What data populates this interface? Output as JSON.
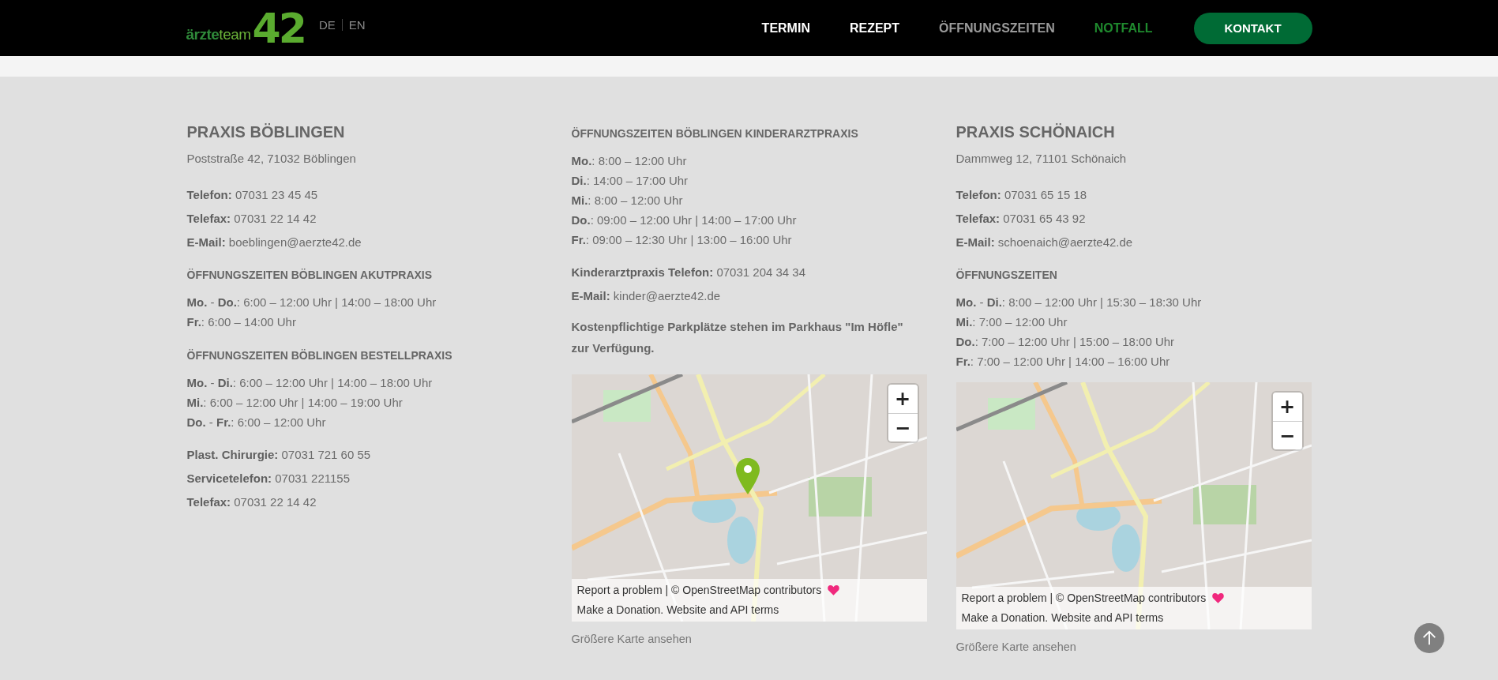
{
  "header": {
    "logo": {
      "word_a": "ärzte",
      "word_b": "team",
      "number": "42"
    },
    "languages": [
      "DE",
      "EN"
    ],
    "nav": [
      {
        "label": "TERMIN",
        "kind": "normal",
        "selected": false
      },
      {
        "label": "REZEPT",
        "kind": "normal",
        "selected": false
      },
      {
        "label": "ÖFFNUNGSZEITEN",
        "kind": "normal",
        "selected": true
      },
      {
        "label": "NOTFALL",
        "kind": "emergency",
        "selected": false
      }
    ],
    "contact_button": "KONTAKT"
  },
  "columns": [
    {
      "blocks": [
        {
          "kind": "heading",
          "text": "PRAXIS BÖBLINGEN"
        },
        {
          "kind": "address",
          "text": "Poststraße 42, 71032 Böblingen"
        },
        {
          "kind": "contacts",
          "lines": [
            "**Telefon:** 07031 23 45 45",
            "**Telefax:** 07031 22 14 42",
            "**E-Mail:** boeblingen@aerzte42.de"
          ]
        },
        {
          "kind": "subheading",
          "text": "ÖFFNUNGSZEITEN BÖBLINGEN AKUTPRAXIS"
        },
        {
          "kind": "hours",
          "lines": [
            "**Mo.** - **Do.**: 6:00 – 12:00 Uhr | 14:00 – 18:00 Uhr",
            "**Fr.**: 6:00 – 14:00 Uhr"
          ]
        },
        {
          "kind": "subheading",
          "text": "ÖFFNUNGSZEITEN BÖBLINGEN BESTELLPRAXIS"
        },
        {
          "kind": "hours",
          "lines": [
            "**Mo.** - **Di.**: 6:00 – 12:00 Uhr | 14:00 – 18:00 Uhr",
            "**Mi.**: 6:00 – 12:00 Uhr | 14:00 – 19:00 Uhr",
            "**Do.** - **Fr.**: 6:00 – 12:00 Uhr"
          ]
        },
        {
          "kind": "contacts",
          "lines": [
            "**Plast. Chirurgie:** 07031 721 60 55",
            "**Servicetelefon:** 07031 221155",
            "**Telefax:** 07031 22 14 42"
          ]
        }
      ]
    },
    {
      "blocks": [
        {
          "kind": "subheading",
          "text": "ÖFFNUNGSZEITEN BÖBLINGEN KINDERARZTPRAXIS"
        },
        {
          "kind": "hours",
          "lines": [
            "**Mo.**: 8:00 – 12:00 Uhr",
            "**Di.**: 14:00 – 17:00 Uhr",
            "**Mi.**: 8:00 – 12:00 Uhr",
            "**Do.**: 09:00 – 12:00 Uhr | 14:00 – 17:00 Uhr",
            "**Fr.**: 09:00 – 12:30 Uhr | 13:00 – 16:00 Uhr"
          ]
        },
        {
          "kind": "contacts",
          "lines": [
            "**Kinderarztpraxis Telefon:** 07031 204 34 34",
            "**E-Mail:** kinder@aerzte42.de"
          ]
        },
        {
          "kind": "note",
          "text": "Kostenpflichtige Parkplätze stehen im Parkhaus \"Im Höfle\" zur Verfügung."
        },
        {
          "kind": "map",
          "marker": true,
          "zoom_in": "+",
          "zoom_out": "−",
          "report": "Report a problem",
          "credit": "| © OpenStreetMap contributors",
          "donation": "Make a Donation.",
          "terms": "Website and API terms",
          "link": "Größere Karte ansehen"
        }
      ]
    },
    {
      "blocks": [
        {
          "kind": "heading",
          "text": "PRAXIS SCHÖNAICH"
        },
        {
          "kind": "address",
          "text": "Dammweg 12, 71101 Schönaich"
        },
        {
          "kind": "contacts",
          "lines": [
            "**Telefon:** 07031 65 15 18",
            "**Telefax:** 07031 65 43 92",
            "**E-Mail:** schoenaich@aerzte42.de"
          ]
        },
        {
          "kind": "subheading",
          "text": "ÖFFNUNGSZEITEN"
        },
        {
          "kind": "hours",
          "lines": [
            "**Mo.** - **Di.**: 8:00 – 12:00 Uhr | 15:30 – 18:30 Uhr",
            "**Mi.**: 7:00 – 12:00 Uhr",
            "**Do.**: 7:00 – 12:00 Uhr | 15:00 – 18:00 Uhr",
            "**Fr.**: 7:00 – 12:00 Uhr | 14:00 – 16:00 Uhr"
          ]
        },
        {
          "kind": "map",
          "marker": false,
          "zoom_in": "+",
          "zoom_out": "−",
          "report": "Report a problem",
          "credit": "| © OpenStreetMap contributors",
          "donation": "Make a Donation.",
          "terms": "Website and API terms",
          "link": "Größere Karte ansehen"
        }
      ]
    }
  ]
}
